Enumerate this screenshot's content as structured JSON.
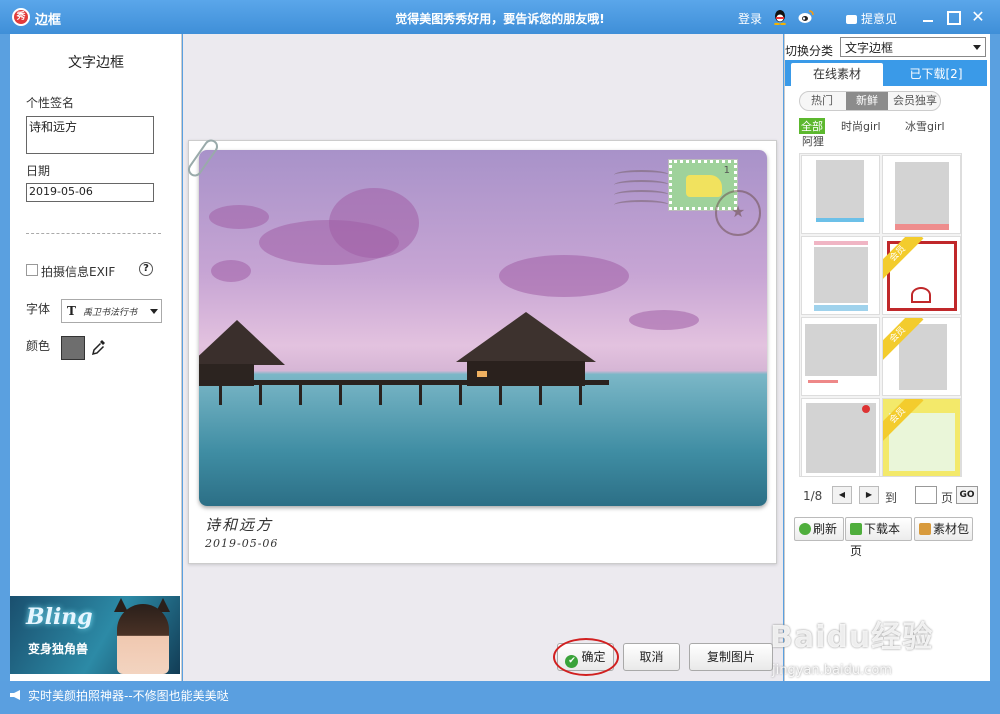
{
  "window": {
    "title": "边框",
    "slogan": "觉得美图秀秀好用，要告诉您的朋友哦!",
    "login": "登录",
    "feedback": "提意见",
    "logo_text": "秀"
  },
  "left": {
    "heading": "文字边框",
    "signature_label": "个性签名",
    "signature_value": "诗和远方",
    "date_label": "日期",
    "date_value": "2019-05-06",
    "exif_label": "拍摄信息EXIF",
    "font_label": "字体",
    "font_name": "禹卫书法行书",
    "color_label": "颜色",
    "color_value": "#6e6e6e",
    "promo_title": "Bling",
    "promo_sub": "变身独角兽"
  },
  "canvas": {
    "caption_signature": "诗和远方",
    "caption_date": "2019-05-06",
    "stamp_number": "1",
    "ok": "确定",
    "cancel": "取消",
    "copy": "复制图片"
  },
  "right": {
    "category_label": "切换分类",
    "category_value": "文字边框",
    "tab_online": "在线素材",
    "tab_downloaded": "已下载[2]",
    "subtab_hot": "热门",
    "subtab_new": "新鲜",
    "subtab_vip": "会员独享",
    "filter_all": "全部",
    "filter_fashion": "时尚girl",
    "filter_ice": "冰雪girl",
    "filter_ali": "阿狸",
    "vip_badge": "会员",
    "page_current": "1/8",
    "goto_label": "到",
    "page_unit": "页",
    "go": "GO",
    "refresh": "刷新",
    "download_page": "下载本页",
    "material_pack": "素材包"
  },
  "status": {
    "text": "实时美颜拍照神器--不修图也能美美哒"
  },
  "watermark": {
    "main": "Baidu经验",
    "sub": "jingyan.baidu.com"
  },
  "colors": {
    "accent": "#3a9ae8",
    "ok_icon": "#3aa33a",
    "highlight_ring": "#d12020",
    "vip": "#f3cc2d",
    "filter_active": "#5cb82e"
  }
}
